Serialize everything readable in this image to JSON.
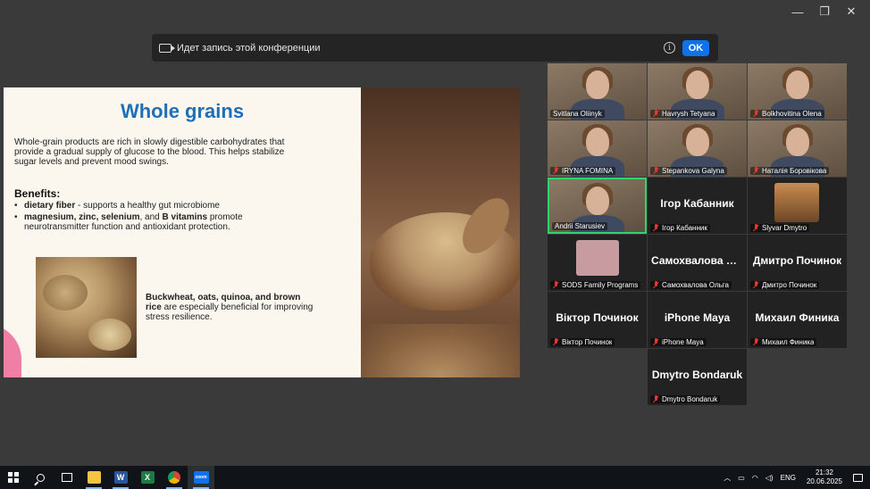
{
  "window": {
    "minimize": "—",
    "restore": "❐",
    "close": "✕"
  },
  "banner": {
    "text": "Идет запись этой конференции",
    "info": "i",
    "ok_label": "OK"
  },
  "slide": {
    "title": "Whole grains",
    "intro": "Whole-grain products are rich in slowly digestible carbohydrates that provide a gradual supply of glucose to the blood. This helps stabilize sugar levels and prevent mood swings.",
    "benefits_title": "Benefits:",
    "bullet1_bold": "dietary fiber",
    "bullet1_rest": " - supports a healthy gut microbiome",
    "bullet2_bold": "magnesium, zinc, selenium",
    "bullet2_mid": ", and ",
    "bullet2_bold2": "B vitamins",
    "bullet2_rest": " promote neurotransmitter function and antioxidant protection.",
    "note_bold": "Buckwheat, oats, quinoa, and brown rice",
    "note_rest": " are especially beneficial for improving stress resilience."
  },
  "participants": [
    {
      "name": "Svitlana Oliinyk",
      "type": "video",
      "muted": false
    },
    {
      "name": "Havrysh Tetyana",
      "type": "video",
      "muted": true
    },
    {
      "name": "Bolkhovitina Olena",
      "type": "video",
      "muted": true
    },
    {
      "name": "IRYNA FOMINA",
      "type": "video",
      "muted": true
    },
    {
      "name": "Stepankova Galyna",
      "type": "video",
      "muted": true
    },
    {
      "name": "Наталія Боровікова",
      "type": "video",
      "muted": true
    },
    {
      "name": "Andrii Starusiev",
      "type": "video",
      "muted": false,
      "active": true
    },
    {
      "name": "Ігор Кабанник",
      "display": "Ігор Кабанник",
      "type": "name",
      "muted": true
    },
    {
      "name": "Slyvar Dmytro",
      "type": "avatar",
      "muted": true
    },
    {
      "name": "SODS Family Programs",
      "type": "avatar-pink",
      "muted": true
    },
    {
      "name": "Самохвалова Ольга",
      "display": "Самохвалова О...",
      "type": "name",
      "muted": true
    },
    {
      "name": "Дмитро Починок",
      "display": "Дмитро Починок",
      "type": "name",
      "muted": true
    },
    {
      "name": "Віктор Починок",
      "display": "Віктор Починок",
      "type": "name",
      "muted": true
    },
    {
      "name": "iPhone Maya",
      "display": "iPhone Maya",
      "type": "name",
      "muted": true
    },
    {
      "name": "Михаил Финика",
      "display": "Михаил Финика",
      "type": "name",
      "muted": true
    },
    {
      "name": "Dmytro Bondaruk",
      "display": "Dmytro Bondaruk",
      "type": "name",
      "muted": true
    }
  ],
  "taskbar": {
    "apps": [
      "start-icon",
      "search-icon",
      "task-view-icon",
      "file-explorer-icon",
      "word-icon",
      "excel-icon",
      "chrome-icon",
      "zoom-icon"
    ],
    "word_letter": "W",
    "excel_letter": "X",
    "zoom_label": "zoom",
    "tray_chevron": "︿",
    "lang": "ENG",
    "time": "21:32",
    "date": "20.06.2025"
  }
}
